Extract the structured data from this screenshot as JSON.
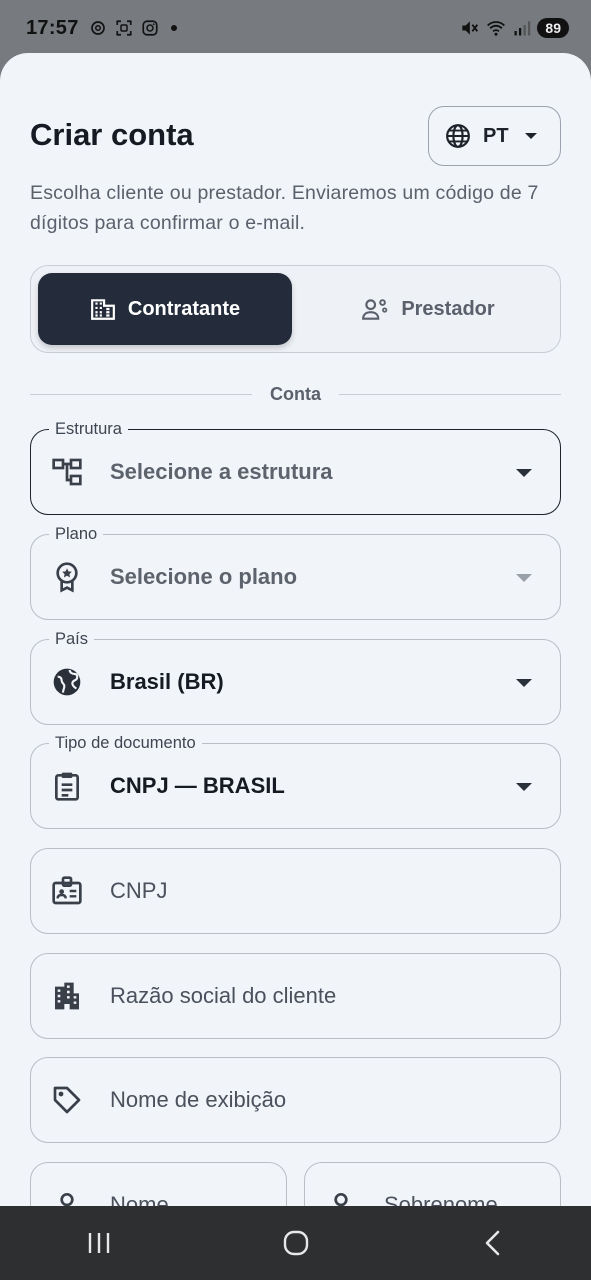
{
  "status_bar": {
    "time": "17:57",
    "battery": "89",
    "left_icons": [
      "openai-icon",
      "screen-record-icon",
      "instagram-icon"
    ],
    "right_icons": [
      "mute-icon",
      "wifi-icon",
      "signal-icon"
    ]
  },
  "header": {
    "title": "Criar conta",
    "language_button": {
      "label": "PT",
      "icon": "globe-icon"
    },
    "subtitle": "Escolha cliente ou prestador. Enviaremos um código de 7 dígitos para confirmar o e-mail."
  },
  "account_type": {
    "selected": "Contratante",
    "options": [
      {
        "label": "Contratante",
        "icon": "building-icon"
      },
      {
        "label": "Prestador",
        "icon": "provider-icon"
      }
    ]
  },
  "section": {
    "label": "Conta"
  },
  "form": {
    "estrutura": {
      "label": "Estrutura",
      "placeholder": "Selecione a estrutura",
      "icon": "hierarchy-icon"
    },
    "plano": {
      "label": "Plano",
      "placeholder": "Selecione o plano",
      "icon": "award-icon"
    },
    "pais": {
      "label": "País",
      "value": "Brasil (BR)",
      "icon": "public-globe-icon"
    },
    "tipo_documento": {
      "label": "Tipo de documento",
      "value": "CNPJ — BRASIL",
      "icon": "clipboard-icon"
    },
    "cnpj": {
      "placeholder": "CNPJ",
      "icon": "badge-icon"
    },
    "razao_social": {
      "placeholder": "Razão social do cliente",
      "icon": "apartment-icon"
    },
    "nome_exibicao": {
      "placeholder": "Nome de exibição",
      "icon": "tag-icon"
    },
    "nome": {
      "placeholder": "Nome",
      "icon": "person-icon"
    },
    "sobrenome": {
      "placeholder": "Sobrenome",
      "icon": "person-icon"
    }
  },
  "colors": {
    "sheet_background": "#f1f4f9",
    "active_segment": "#242c3b",
    "nav_bar": "#2e2f31"
  }
}
